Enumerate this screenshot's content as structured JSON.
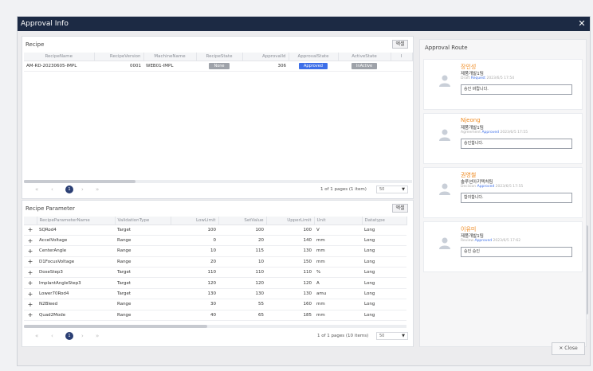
{
  "dialog": {
    "title": "Approval Info",
    "close_symbol": "✕",
    "close_button_label": "✕ Close"
  },
  "recipe": {
    "section_title": "Recipe",
    "excel_label": "엑셀",
    "columns": [
      "RecipeName",
      "RecipeVersion",
      "MachineName",
      "RecipeState",
      "ApprovalId",
      "ApprovalState",
      "ActiveState",
      "I"
    ],
    "rows": [
      {
        "name": "AM-RD-20230605-IMPL",
        "version": "0001",
        "machine": "WEB01-IMPL",
        "recipe_state": "None",
        "approval_id": "306",
        "approval_state": "Approved",
        "active_state": "InActive"
      }
    ],
    "pager": {
      "page": "1",
      "info": "1 of 1 pages (1 item)",
      "page_size": "50"
    }
  },
  "recipe_parameter": {
    "section_title": "Recipe Parameter",
    "excel_label": "엑셀",
    "columns": [
      "",
      "RecipeParameterName",
      "ValidationType",
      "LowLimit",
      "SetValue",
      "UpperLimit",
      "Unit",
      "Datatype"
    ],
    "rows": [
      {
        "name": "SQRod4",
        "vtype": "Target",
        "low": "100",
        "set": "100",
        "up": "100",
        "unit": "V",
        "dtype": "Long"
      },
      {
        "name": "AccelVoltage",
        "vtype": "Range",
        "low": "0",
        "set": "20",
        "up": "140",
        "unit": "mm",
        "dtype": "Long"
      },
      {
        "name": "CenterAngle",
        "vtype": "Range",
        "low": "10",
        "set": "115",
        "up": "130",
        "unit": "mm",
        "dtype": "Long"
      },
      {
        "name": "D1FocusVoltage",
        "vtype": "Range",
        "low": "20",
        "set": "10",
        "up": "150",
        "unit": "mm",
        "dtype": "Long"
      },
      {
        "name": "DoseStep3",
        "vtype": "Target",
        "low": "110",
        "set": "110",
        "up": "110",
        "unit": "%",
        "dtype": "Long"
      },
      {
        "name": "ImplantAngleStep3",
        "vtype": "Target",
        "low": "120",
        "set": "120",
        "up": "120",
        "unit": "A",
        "dtype": "Long"
      },
      {
        "name": "Lower70Rod4",
        "vtype": "Target",
        "low": "130",
        "set": "130",
        "up": "130",
        "unit": "amu",
        "dtype": "Long"
      },
      {
        "name": "N2Bleed",
        "vtype": "Range",
        "low": "30",
        "set": "55",
        "up": "160",
        "unit": "mm",
        "dtype": "Long"
      },
      {
        "name": "Quad2Mode",
        "vtype": "Range",
        "low": "40",
        "set": "65",
        "up": "185",
        "unit": "mm",
        "dtype": "Long"
      }
    ],
    "pager": {
      "page": "1",
      "info": "1 of 1 pages (10 items)",
      "page_size": "50"
    }
  },
  "approval_route": {
    "title": "Approval Route",
    "cards": [
      {
        "name": "장인성",
        "dept": "제품개발1팀",
        "role": "Draft",
        "status": "Request",
        "date": "2023/6/5 17:54",
        "comment": "승인 바랍니다."
      },
      {
        "name": "Njeong",
        "dept": "제품개발1팀",
        "role": "Agreement",
        "status": "Approved",
        "date": "2023/6/5 17:55",
        "comment": "승인합니다."
      },
      {
        "name": "권영철",
        "dept": "솔루션아키텍처팀",
        "role": "Decision",
        "status": "Approved",
        "date": "2023/6/5 17:55",
        "comment": "합의합니다."
      },
      {
        "name": "이유미",
        "dept": "제품개발1팀",
        "role": "Review",
        "status": "Approved",
        "date": "2023/6/5 17:62",
        "comment": "승인 승인"
      }
    ]
  }
}
